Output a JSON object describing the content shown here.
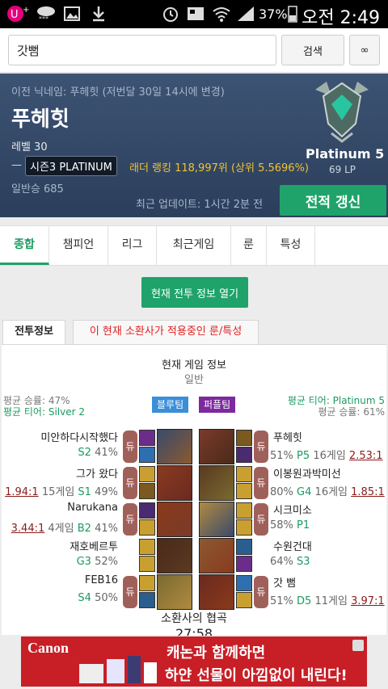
{
  "status_bar": {
    "battery": "37%",
    "time": "오전 2:49"
  },
  "search": {
    "value": "갓뻠",
    "button": "검색",
    "extra_button": "∞"
  },
  "profile": {
    "previous_name": "이전 닉네임: 푸헤힛 (저번달 30일 14시에 변경)",
    "name": "푸헤힛",
    "level": "레벨 30",
    "dash": "—",
    "season_badge": "시즌3 PLATINUM",
    "ladder": "래더 랭킹 118,997위 (상위 5.5696%)",
    "normal_wins": "일반승 685",
    "updated": "최근 업데이트: 1시간 2분 전",
    "refresh_button": "전적 갱신",
    "tier": "Platinum 5",
    "lp": "69 LP"
  },
  "tabs": [
    "종합",
    "챔피언",
    "리그",
    "최근게임",
    "룬",
    "특성"
  ],
  "open_button": "현재 전투 정보 열기",
  "subtabs": [
    "전투정보",
    "이 현재 소환사가 적용중인 룬/특성"
  ],
  "game": {
    "title": "현재 게임 정보",
    "type": "일반",
    "blue": {
      "badge": "블루팀",
      "avg_winrate": "평균 승률: 47%",
      "avg_tier": "평균 티어: Silver 2"
    },
    "purple": {
      "badge": "퍼플팀",
      "avg_tier": "평균 티어: Platinum 5",
      "avg_winrate": "평균 승률: 61%"
    },
    "duo_label": "듀",
    "blue_players": [
      {
        "name": "미안하다시작했다",
        "tier": "S2",
        "pct": "41%",
        "games": "",
        "kda": "",
        "duo": true
      },
      {
        "name": "그가 왔다",
        "tier": "S1",
        "pct": "49%",
        "games": "15게임",
        "kda": "1.94:1",
        "duo": true
      },
      {
        "name": "Narukana",
        "tier": "B2",
        "pct": "41%",
        "games": "4게임",
        "kda": "3.44:1",
        "duo": true
      },
      {
        "name": "재호베르투",
        "tier": "G3",
        "pct": "52%",
        "games": "",
        "kda": "",
        "duo": false
      },
      {
        "name": "FEB16",
        "tier": "S4",
        "pct": "50%",
        "games": "",
        "kda": "",
        "duo": true
      }
    ],
    "purple_players": [
      {
        "name": "푸헤힛",
        "pct": "51%",
        "tier": "P5",
        "games": "16게임",
        "kda": "2.53:1",
        "duo": true
      },
      {
        "name": "이봉원과박미선",
        "pct": "80%",
        "tier": "G4",
        "games": "16게임",
        "kda": "1.85:1",
        "duo": true
      },
      {
        "name": "시크미소",
        "pct": "58%",
        "tier": "P1",
        "games": "",
        "kda": "",
        "duo": true
      },
      {
        "name": "수원건대",
        "pct": "64%",
        "tier": "S3",
        "games": "",
        "kda": "",
        "duo": false
      },
      {
        "name": "갓 뻠",
        "pct": "51%",
        "tier": "D5",
        "games": "11게임",
        "kda": "3.97:1",
        "duo": true
      }
    ],
    "map": "소환사의 협곡",
    "time": "27:58"
  },
  "ad": {
    "brand": "Canon",
    "line1": "캐논과 함께하면",
    "line2": "하얀 선물이 아낌없이 내린다!"
  },
  "colors": {
    "accent_green": "#1fa36a",
    "blue_team": "#3a8fd8",
    "purple_team": "#7d2a9e",
    "ad_red": "#c81e26"
  }
}
